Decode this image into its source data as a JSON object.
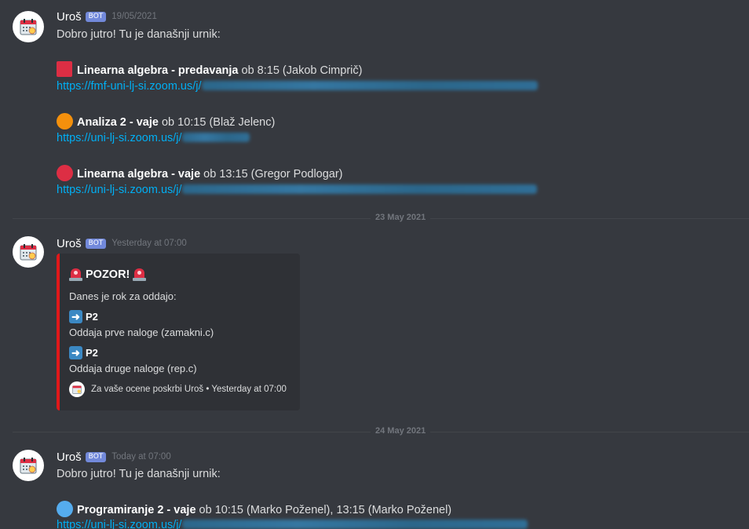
{
  "colors": {
    "background": "#36393f",
    "link": "#00aff4",
    "bot_tag": "#7289da",
    "embed_border": "#e0181a",
    "embed_bg": "#2f3136",
    "red_square": "#dd2e44",
    "orange_circle": "#f4900c",
    "red_circle": "#dd2e44",
    "blue_circle": "#55acee"
  },
  "messages": [
    {
      "username": "Uroš",
      "bot_tag": "BOT",
      "timestamp": "19/05/2021",
      "intro": "Dobro jutro! Tu je današnji urnik:",
      "classes": [
        {
          "icon": "red-square-icon",
          "title": "Linearna algebra - predavanja",
          "details": " ob 8:15 (Jakob Cimprič)",
          "link": "https://fmf-uni-lj-si.zoom.us/j/"
        },
        {
          "icon": "orange-circle-icon",
          "title": "Analiza 2 - vaje",
          "details": " ob 10:15 (Blaž Jelenc)",
          "link": "https://uni-lj-si.zoom.us/j/"
        },
        {
          "icon": "red-circle-icon",
          "title": "Linearna algebra - vaje",
          "details": " ob 13:15 (Gregor Podlogar)",
          "link": "https://uni-lj-si.zoom.us/j/"
        }
      ]
    },
    {
      "username": "Uroš",
      "bot_tag": "BOT",
      "timestamp": "Yesterday at 07:00",
      "embed": {
        "title": "POZOR!",
        "description": "Danes je rok za oddajo:",
        "fields": [
          {
            "name": "P2",
            "value": "Oddaja prve naloge (zamakni.c)"
          },
          {
            "name": "P2",
            "value": "Oddaja druge naloge (rep.c)"
          }
        ],
        "footer": "Za vaše ocene poskrbi Uroš • Yesterday at 07:00"
      }
    },
    {
      "username": "Uroš",
      "bot_tag": "BOT",
      "timestamp": "Today at 07:00",
      "intro": "Dobro jutro! Tu je današnji urnik:",
      "classes": [
        {
          "icon": "blue-circle-icon",
          "title": "Programiranje 2 - vaje",
          "details": " ob 10:15 (Marko Poženel), 13:15 (Marko Poženel)",
          "link": "https://uni-lj-si.zoom.us/j/"
        }
      ]
    }
  ],
  "dividers": [
    "23 May 2021",
    "24 May 2021"
  ]
}
